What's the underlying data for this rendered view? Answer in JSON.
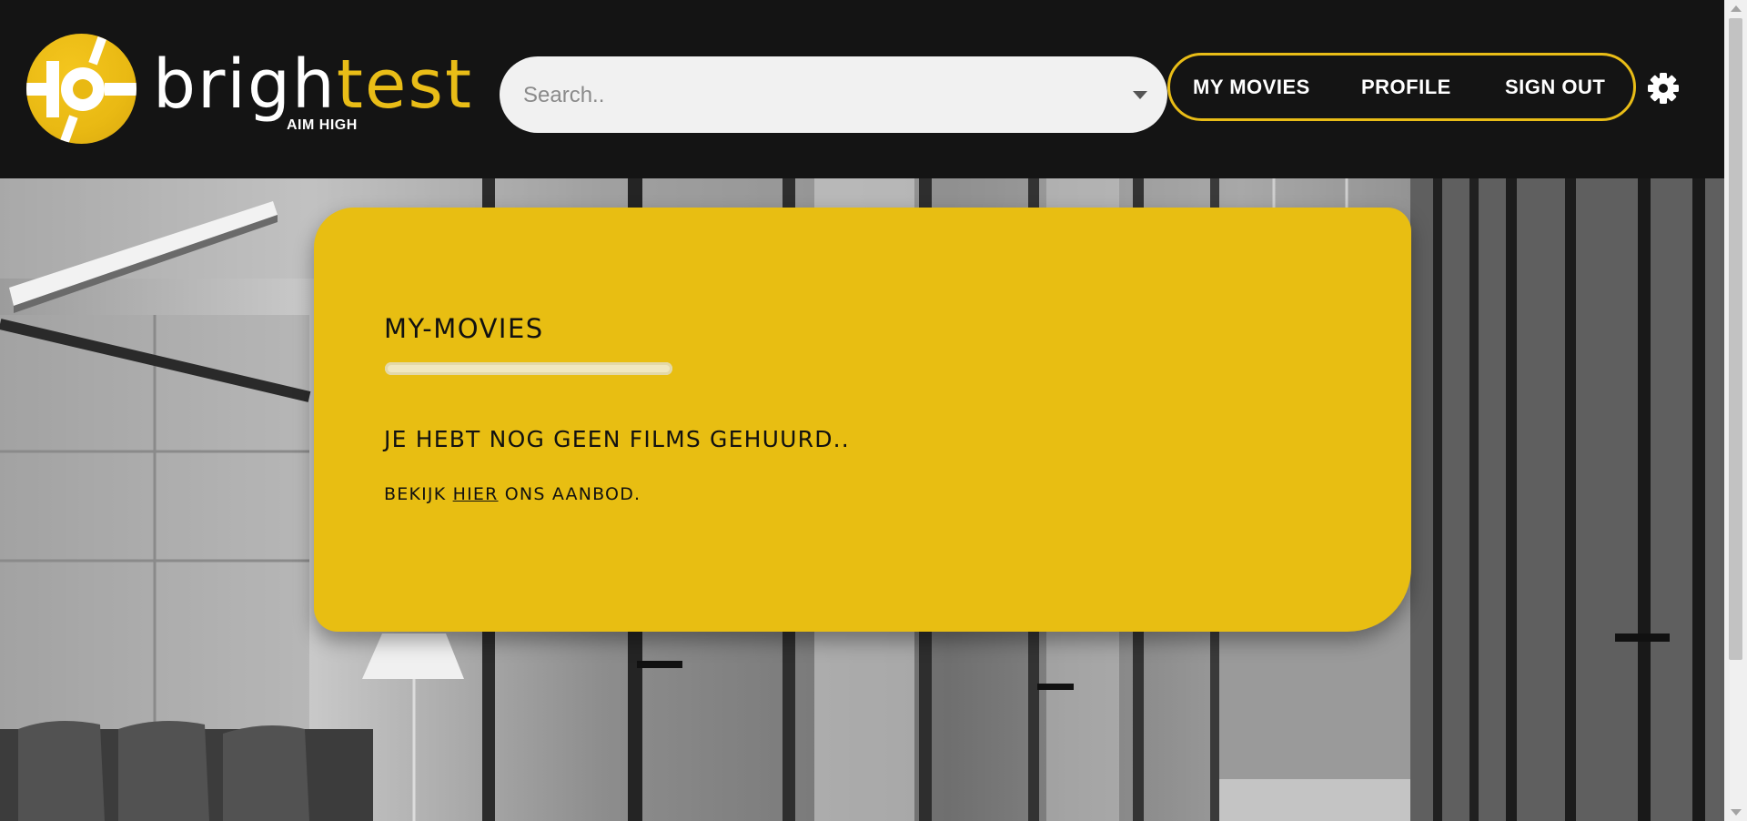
{
  "brand": {
    "name_part1": "brigh",
    "name_part2": "test",
    "tagline": "AIM HIGH",
    "accent_color": "#e9bd17"
  },
  "search": {
    "placeholder": "Search..",
    "value": "",
    "dropdown_icon": "caret-down-icon"
  },
  "nav": {
    "items": [
      {
        "label": "MY MOVIES"
      },
      {
        "label": "PROFILE"
      },
      {
        "label": "SIGN OUT"
      }
    ],
    "settings_icon": "gear-icon"
  },
  "card": {
    "title": "MY-MOVIES",
    "heading": "JE HEBT NOG GEEN FILMS GEHUURD..",
    "text_before": "BEKIJK ",
    "link_label": "HIER",
    "text_after": " ONS AANBOD.",
    "background_color": "#e8be12"
  }
}
